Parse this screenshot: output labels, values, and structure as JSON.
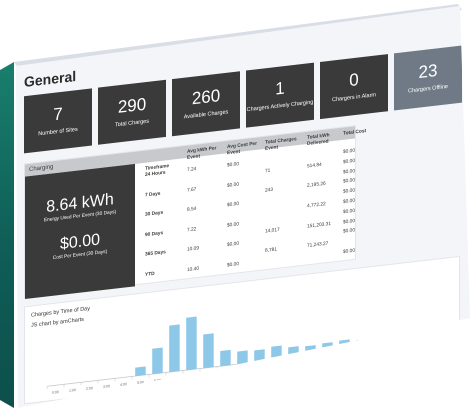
{
  "page": {
    "title": "General"
  },
  "tiles": [
    {
      "value": "7",
      "label": "Number of Sites"
    },
    {
      "value": "290",
      "label": "Total Charges"
    },
    {
      "value": "260",
      "label": "Available Charges"
    },
    {
      "value": "1",
      "label": "Chargers Actively Charging"
    },
    {
      "value": "0",
      "label": "Chargers in Alarm"
    },
    {
      "value": "23",
      "label": "Chargers Offline"
    }
  ],
  "charging": {
    "header": "Charging",
    "energy_value": "8.64 kWh",
    "energy_label": "Energy Used Per Event (30 Days)",
    "cost_value": "$0.00",
    "cost_label": "Cost Per Event (30 Days)",
    "columns": [
      "Timeframe",
      "Avg kWh Per Event",
      "Avg Cost Per Event",
      "Total Charges Event",
      "Total kWh Delivered",
      "Total Cost"
    ],
    "rows": [
      {
        "timeframe": "24 Hours",
        "avg_kwh": "7.24",
        "avg_cost": "$0.00",
        "charges": "",
        "kwh": "",
        "cost": "$0.00"
      },
      {
        "timeframe": "",
        "avg_kwh": "",
        "avg_cost": "",
        "charges": "71",
        "kwh": "514.84",
        "cost": "$0.00"
      },
      {
        "timeframe": "7 Days",
        "avg_kwh": "7.67",
        "avg_cost": "$0.00",
        "charges": "",
        "kwh": "",
        "cost": "$0.00"
      },
      {
        "timeframe": "",
        "avg_kwh": "",
        "avg_cost": "",
        "charges": "243",
        "kwh": "2,195.26",
        "cost": "$0.00"
      },
      {
        "timeframe": "30 Days",
        "avg_kwh": "8.54",
        "avg_cost": "$0.00",
        "charges": "",
        "kwh": "",
        "cost": "$0.00"
      },
      {
        "timeframe": "",
        "avg_kwh": "",
        "avg_cost": "",
        "charges": "",
        "kwh": "4,772.22",
        "cost": "$0.00"
      },
      {
        "timeframe": "90 Days",
        "avg_kwh": "7.22",
        "avg_cost": "$0.00",
        "charges": "",
        "kwh": "",
        "cost": "$0.00"
      },
      {
        "timeframe": "",
        "avg_kwh": "",
        "avg_cost": "",
        "charges": "14,017",
        "kwh": "151,203.31",
        "cost": "$0.00"
      },
      {
        "timeframe": "365 Days",
        "avg_kwh": "10.09",
        "avg_cost": "$0.00",
        "charges": "",
        "kwh": "",
        "cost": "$0.00"
      },
      {
        "timeframe": "",
        "avg_kwh": "",
        "avg_cost": "",
        "charges": "8,781",
        "kwh": "71,243.27",
        "cost": ""
      },
      {
        "timeframe": "YTD",
        "avg_kwh": "10.40",
        "avg_cost": "$0.00",
        "charges": "",
        "kwh": "",
        "cost": "$0.00"
      }
    ]
  },
  "chart": {
    "title": "Charges by Time of Day",
    "credit": "JS chart by amCharts",
    "bar_color": "#8ec8e8",
    "axis_color": "#c4c6cc"
  },
  "chart_data": {
    "type": "bar",
    "title": "Charges by Time of Day",
    "categories": [
      "0:00",
      "1:00",
      "2:00",
      "3:00",
      "4:00",
      "5:00",
      "6:00",
      "7:00",
      "8:00",
      "9:00",
      "10:00",
      "11:00",
      "12:00",
      "13:00",
      "14:00",
      "15:00",
      "16:00",
      "17:00",
      "18:00",
      "19:00",
      "20:00",
      "21:00",
      "22:00",
      "23:00"
    ],
    "values": [
      0,
      0,
      0,
      0,
      0,
      10,
      30,
      55,
      62,
      40,
      18,
      15,
      14,
      16,
      13,
      12,
      13,
      14,
      12,
      11,
      10,
      9,
      8,
      6
    ],
    "ylim": [
      0,
      70
    ],
    "grid": false
  }
}
